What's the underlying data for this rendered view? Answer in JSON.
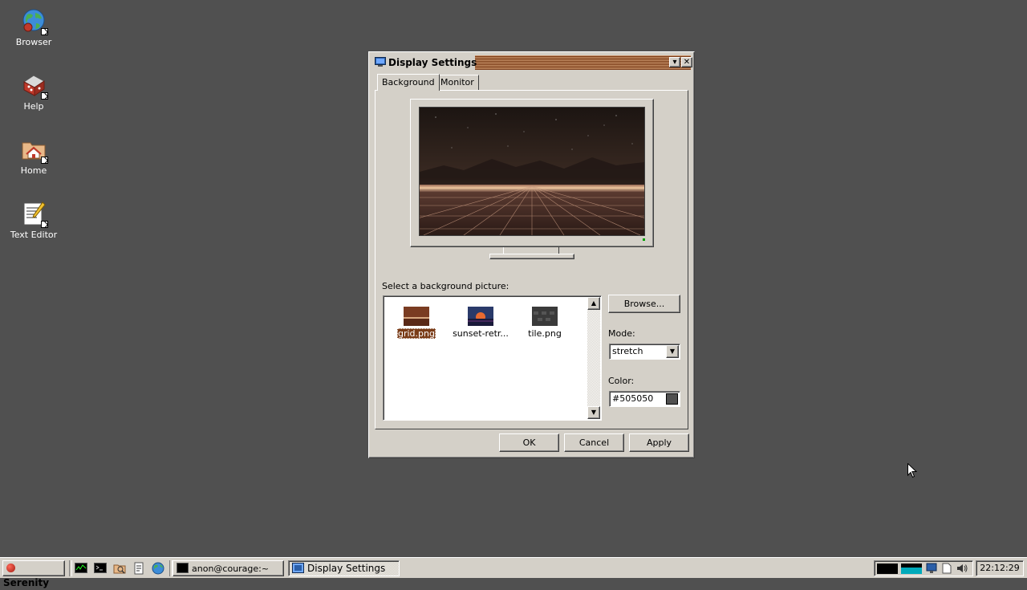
{
  "desktop": {
    "icons": [
      {
        "label": "Browser",
        "icon": "globe-icon"
      },
      {
        "label": "Help",
        "icon": "help-book-icon"
      },
      {
        "label": "Home",
        "icon": "home-folder-icon"
      },
      {
        "label": "Text Editor",
        "icon": "text-editor-icon"
      }
    ]
  },
  "window": {
    "title": "Display Settings",
    "menu_glyph": "▾",
    "close_glyph": "✕",
    "tabs": [
      {
        "label": "Background",
        "active": true
      },
      {
        "label": "Monitor",
        "active": false
      }
    ],
    "select_label": "Select a background picture:",
    "files": [
      {
        "name": "grid.png",
        "selected": true
      },
      {
        "name": "sunset-retr...",
        "selected": false
      },
      {
        "name": "tile.png",
        "selected": false
      }
    ],
    "browse_label": "Browse...",
    "mode_label": "Mode:",
    "mode_value": "stretch",
    "color_label": "Color:",
    "color_value": "#505050",
    "buttons": {
      "ok": "OK",
      "cancel": "Cancel",
      "apply": "Apply"
    }
  },
  "taskbar": {
    "start_label": "Serenity",
    "apps": [
      {
        "label": "anon@courage:~",
        "pressed": false
      },
      {
        "label": "Display Settings",
        "pressed": true
      }
    ],
    "clock": "22:12:29"
  },
  "colors": {
    "desktop_bg": "#505050",
    "window_bg": "#d4d0c8",
    "title_accent": "#7a3c18",
    "selection": "#7a3c18"
  }
}
